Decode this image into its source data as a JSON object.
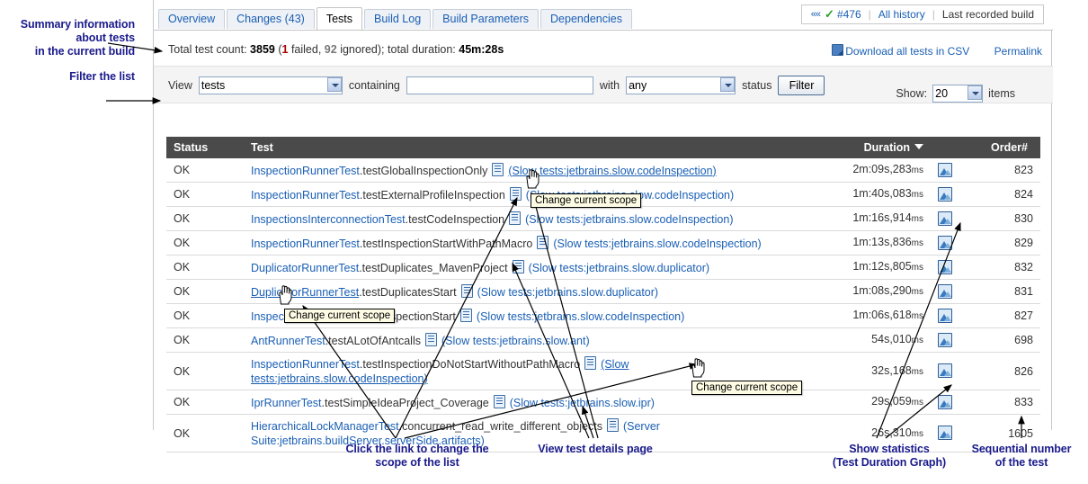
{
  "annotations": [
    {
      "id": "summary",
      "text": "Summary information\nabout tests\nin the current build"
    },
    {
      "id": "filter",
      "text": "Filter the list"
    },
    {
      "id": "scope",
      "text": "Click the link to change the\nscope of the list"
    },
    {
      "id": "details",
      "text": "View test details page"
    },
    {
      "id": "stats",
      "text": "Show statistics\n(Test Duration Graph)"
    },
    {
      "id": "order",
      "text": "Sequential number\nof the test"
    }
  ],
  "tabs": [
    {
      "label": "Overview",
      "active": false
    },
    {
      "label": "Changes (43)",
      "active": false
    },
    {
      "label": "Tests",
      "active": true
    },
    {
      "label": "Build Log",
      "active": false
    },
    {
      "label": "Build Parameters",
      "active": false
    },
    {
      "label": "Dependencies",
      "active": false
    }
  ],
  "build_nav": {
    "prev_icon": "««",
    "status_icon": "check-mark",
    "build_number": "#476",
    "all_history": "All history",
    "last_recorded": "Last recorded build"
  },
  "summary": {
    "label_count": "Total test count:",
    "count": "3859",
    "open_paren": "(",
    "failed_num": "1",
    "failed_word": "failed,",
    "ignored_num": "92",
    "ignored_word": "ignored);",
    "label_duration": "total duration:",
    "duration": "45m:28s"
  },
  "top_links": {
    "download_csv": "Download all tests in CSV",
    "permalink": "Permalink"
  },
  "filter_bar": {
    "view_label": "View",
    "view_value": "tests",
    "containing_label": "containing",
    "containing_value": "",
    "containing_placeholder": "",
    "with_label": "with",
    "status_value": "any",
    "status_label": "status",
    "filter_button": "Filter",
    "show_label": "Show:",
    "show_value": "20",
    "items_label": "items"
  },
  "table": {
    "headers": {
      "status": "Status",
      "test": "Test",
      "duration": "Duration",
      "order": "Order#"
    },
    "sorted_by": "duration",
    "rows": [
      {
        "status": "OK",
        "cls": "InspectionRunnerTest",
        "meth": ".testGlobalInspectionOnly",
        "scope": "(Slow tests:jetbrains.slow.codeInspection)",
        "scope_underline": true,
        "duration": "2m:09s,283",
        "unit": "ms",
        "order": "823"
      },
      {
        "status": "OK",
        "cls": "InspectionRunnerTest",
        "meth": ".testExternalProfileInspection",
        "scope": "(Slow tests:jetbrains.slow.codeInspection)",
        "scope_underline": false,
        "duration": "1m:40s,083",
        "unit": "ms",
        "order": "824"
      },
      {
        "status": "OK",
        "cls": "InspectionsInterconnectionTest",
        "meth": ".testCodeInspection",
        "scope": "(Slow tests:jetbrains.slow.codeInspection)",
        "scope_underline": false,
        "duration": "1m:16s,914",
        "unit": "ms",
        "order": "830"
      },
      {
        "status": "OK",
        "cls": "InspectionRunnerTest",
        "meth": ".testInspectionStartWithPathMacro",
        "scope": "(Slow tests:jetbrains.slow.codeInspection)",
        "scope_underline": false,
        "duration": "1m:13s,836",
        "unit": "ms",
        "order": "829"
      },
      {
        "status": "OK",
        "cls": "DuplicatorRunnerTest",
        "meth": ".testDuplicates_MavenProject",
        "scope": "(Slow tests:jetbrains.slow.duplicator)",
        "scope_underline": false,
        "duration": "1m:12s,805",
        "unit": "ms",
        "order": "832"
      },
      {
        "status": "OK",
        "cls": "DuplicatorRunnerTest",
        "meth": ".testDuplicatesStart",
        "scope": "(Slow tests:jetbrains.slow.duplicator)",
        "scope_underline": false,
        "cls_underline": true,
        "duration": "1m:08s,290",
        "unit": "ms",
        "order": "831"
      },
      {
        "status": "OK",
        "cls": "InspectionRunnerTest",
        "meth": ".testInspectionStart",
        "scope": "(Slow tests:jetbrains.slow.codeInspection)",
        "scope_underline": false,
        "duration": "1m:06s,618",
        "unit": "ms",
        "order": "827"
      },
      {
        "status": "OK",
        "cls": "AntRunnerTest",
        "meth": ".testALotOfAntcalls",
        "scope": "(Slow tests:jetbrains.slow.ant)",
        "scope_underline": false,
        "duration": "54s,010",
        "unit": "ms",
        "order": "698"
      },
      {
        "status": "OK",
        "cls": "InspectionRunnerTest",
        "meth": ".testInspectionDoNotStartWithoutPathMacro",
        "scope": "(Slow tests:jetbrains.slow.codeInspection)",
        "scope_underline": true,
        "duration": "32s,168",
        "unit": "ms",
        "order": "826"
      },
      {
        "status": "OK",
        "cls": "IprRunnerTest",
        "meth": ".testSimpleIdeaProject_Coverage",
        "scope": "(Slow tests:jetbrains.slow.ipr)",
        "scope_underline": false,
        "duration": "29s,059",
        "unit": "ms",
        "order": "833"
      },
      {
        "status": "OK",
        "cls": "HierarchicalLockManagerTest",
        "meth": ".concurrent_read_write_different_objects",
        "scope": "(Server Suite:jetbrains.buildServer.serverSide.artifacts)",
        "scope_underline": false,
        "duration": "26s,310",
        "unit": "ms",
        "order": "1605"
      }
    ]
  },
  "tooltips": [
    {
      "id": "tt1",
      "text": "Change current scope"
    },
    {
      "id": "tt2",
      "text": "Change current scope"
    },
    {
      "id": "tt3",
      "text": "Change current scope"
    }
  ],
  "colors": {
    "link": "#1a5fb4",
    "annotation": "#1a1a8c",
    "header_bg": "#4a4a4a",
    "tooltip_bg": "#fdfbe3",
    "fail": "#b00000",
    "ok": "#2aa02a"
  }
}
